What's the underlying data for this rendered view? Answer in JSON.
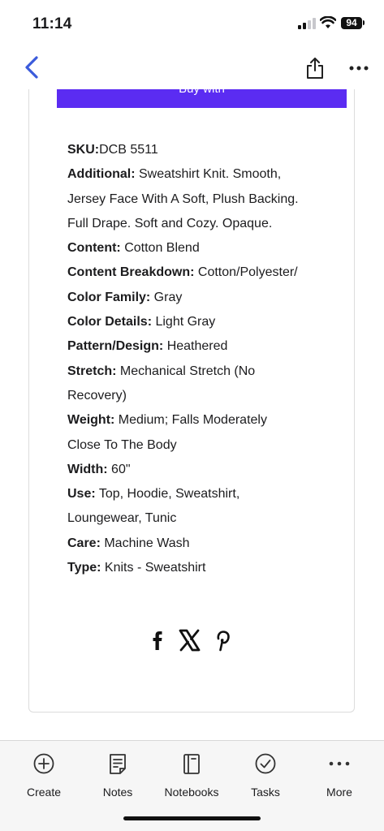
{
  "status_bar": {
    "time": "11:14",
    "battery": "94"
  },
  "buy_button": {
    "label": "Buy with"
  },
  "specs": [
    {
      "label": "SKU:",
      "value": "DCB 5511"
    },
    {
      "label": "Additional:",
      "value": " Sweatshirt Knit. Smooth,"
    },
    {
      "label": "",
      "value": "Jersey Face With A Soft, Plush Backing."
    },
    {
      "label": "",
      "value": "Full Drape. Soft and Cozy. Opaque."
    },
    {
      "label": "Content:",
      "value": " Cotton Blend"
    },
    {
      "label": "Content Breakdown:",
      "value": " Cotton/Polyester/"
    },
    {
      "label": "Color Family:",
      "value": " Gray"
    },
    {
      "label": "Color Details:",
      "value": " Light Gray"
    },
    {
      "label": "Pattern/Design:",
      "value": " Heathered"
    },
    {
      "label": "Stretch:",
      "value": " Mechanical Stretch (No"
    },
    {
      "label": "",
      "value": "Recovery)"
    },
    {
      "label": "Weight:",
      "value": " Medium; Falls Moderately"
    },
    {
      "label": "",
      "value": "Close To The Body"
    },
    {
      "label": "Width:",
      "value": " 60\""
    },
    {
      "label": "Use:",
      "value": " Top, Hoodie, Sweatshirt,"
    },
    {
      "label": "",
      "value": "Loungewear, Tunic"
    },
    {
      "label": "Care:",
      "value": " Machine Wash"
    },
    {
      "label": "Type:",
      "value": " Knits - Sweatshirt"
    }
  ],
  "social": [
    "facebook-icon",
    "x-icon",
    "pinterest-icon"
  ],
  "tabs": [
    {
      "label": "Create",
      "icon": "plus-circle-icon"
    },
    {
      "label": "Notes",
      "icon": "note-icon"
    },
    {
      "label": "Notebooks",
      "icon": "notebook-icon"
    },
    {
      "label": "Tasks",
      "icon": "check-circle-icon"
    },
    {
      "label": "More",
      "icon": "ellipsis-icon"
    }
  ],
  "colors": {
    "accent": "#3b5bdb",
    "buy_button": "#5b2cf2"
  }
}
